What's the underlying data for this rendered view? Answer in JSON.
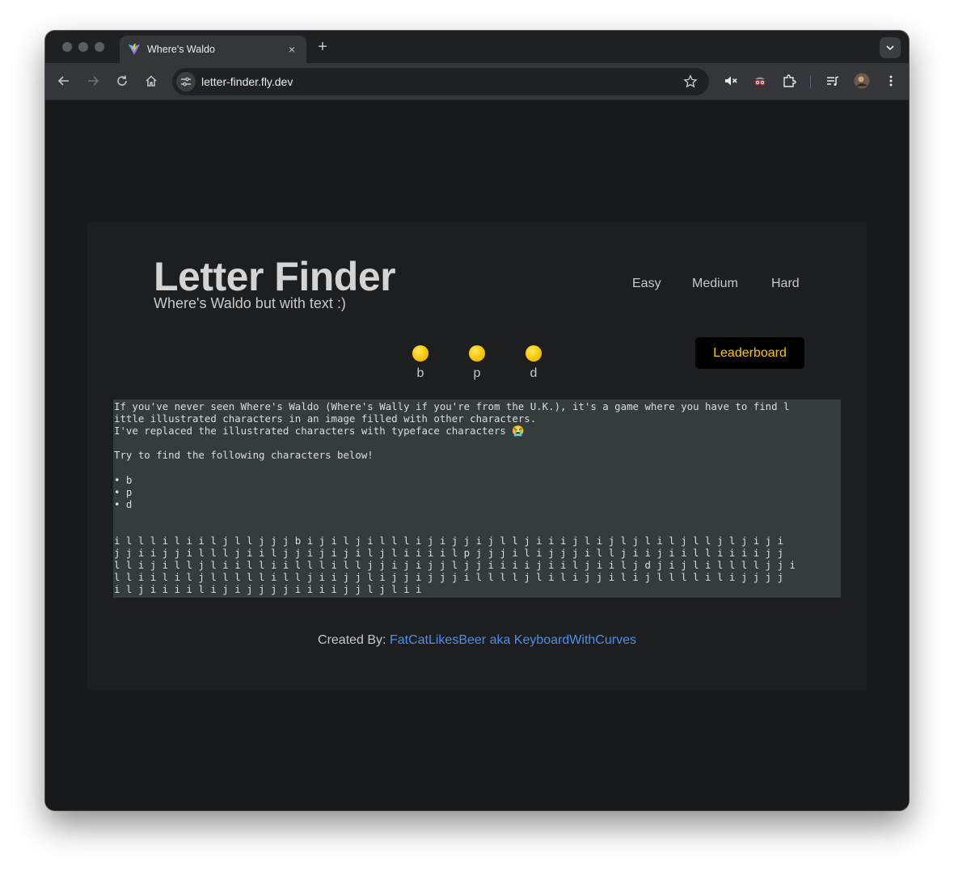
{
  "browser": {
    "tab_title": "Where's Waldo",
    "tab_close": "×",
    "new_tab": "+",
    "url": "letter-finder.fly.dev"
  },
  "page": {
    "title": "Letter Finder",
    "subtitle": "Where's Waldo but with text :)",
    "difficulties": [
      "Easy",
      "Medium",
      "Hard"
    ],
    "targets": [
      "b",
      "p",
      "d"
    ],
    "leaderboard_label": "Leaderboard",
    "intro_lines": [
      "If you've never seen Where's Waldo (Where's Wally if you're from the U.K.), it's a game where you have to find l",
      "ittle illustrated characters in an image filled with other characters.",
      "I've replaced the illustrated characters with typeface characters 😭",
      "",
      "Try to find the following characters below!",
      "",
      "• b",
      "• p",
      "• d"
    ],
    "letter_grid": [
      "i l l l i l i i l j l l j j j b i j i l j i l l l i j i j j i j l l j i i i j l i j l j l i l j l l j l j i j i",
      "j j i i j j i l l l j i i l j j i j i j i l j l i i i i l p j j j i l i j j j i l l j i i j i i l l i i i i j j",
      "l l i j i l l j l i i l l i i l l l i l l j j i j i j j l j j i i i i j i i l j i i l j d j i j l i l l l l j j i",
      "l l i i l i l j l l l l l i l l j i i j j l i j j i j j j i l l l l j l i l i j j i l i j l l l l i l i j j j j",
      "i l j i i i i l i j i j j j j i i i i j j l j l i i"
    ],
    "footer_prefix": "Created By: ",
    "footer_link": "FatCatLikesBeer aka KeyboardWithCurves"
  }
}
